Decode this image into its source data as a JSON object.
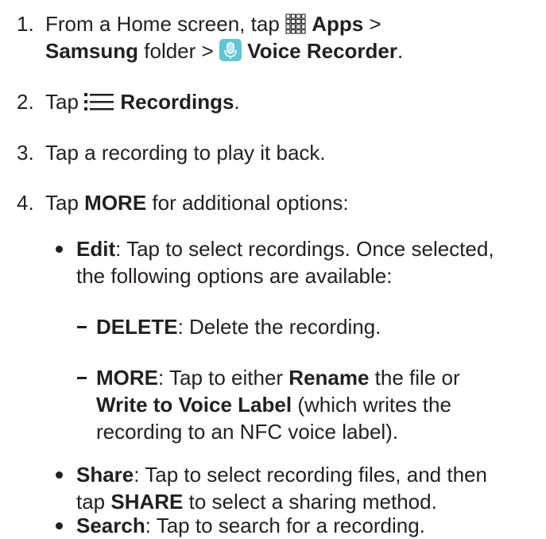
{
  "steps": [
    {
      "number": "1.",
      "line1": {
        "pre": "From a Home screen, tap ",
        "apps": "Apps",
        "sep": " >"
      },
      "line2": {
        "samsung": "Samsung",
        "folder": " folder > ",
        "app": "Voice Recorder",
        "end": "."
      }
    },
    {
      "number": "2.",
      "pre": "Tap ",
      "bold": "Recordings",
      "end": "."
    },
    {
      "number": "3.",
      "text": "Tap a recording to play it back."
    },
    {
      "number": "4.",
      "pre": "Tap ",
      "bold": "MORE",
      "post": " for additional options:"
    }
  ],
  "options": [
    {
      "label": "Edit",
      "line1": ": Tap to select recordings. Once selected,",
      "line2": "the following options are available:",
      "sub": [
        {
          "label": "DELETE",
          "text": ": Delete the recording."
        },
        {
          "label": "MORE",
          "text1": ": Tap to either ",
          "rename": "Rename",
          "text2": " the file or",
          "write": "Write to Voice Label",
          "text3": " (which writes the",
          "text4": "recording to an NFC voice label)."
        }
      ]
    },
    {
      "label": "Share",
      "line1": ": Tap to select recording files, and then",
      "line2_pre": "tap ",
      "line2_bold": "SHARE",
      "line2_post": " to select a sharing method."
    },
    {
      "label": "Search",
      "line1": ": Tap to search for a recording."
    }
  ],
  "icons": {
    "apps": "apps-grid-icon",
    "voice_recorder": "voice-recorder-app-icon",
    "recordings": "list-menu-icon",
    "voice_recorder_color": "#5ec6d6"
  }
}
